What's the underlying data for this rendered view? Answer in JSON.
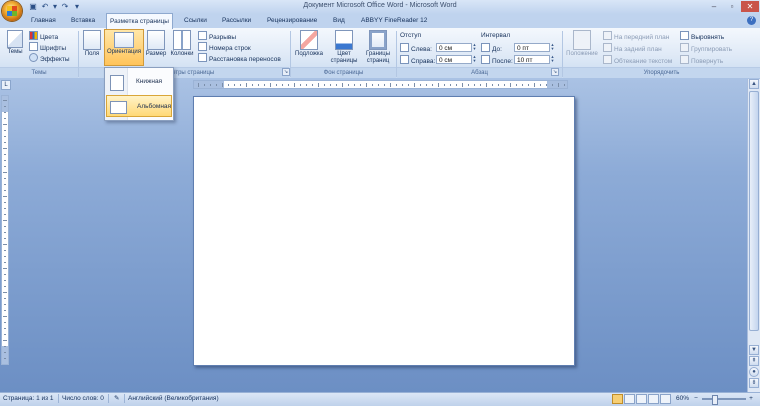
{
  "window": {
    "title": "Документ Microsoft Office Word - Microsoft Word",
    "controls": [
      "–",
      "▫",
      "✕"
    ]
  },
  "qat": {
    "save": "▣",
    "undo": "↶",
    "redo": "↷",
    "more": "▾"
  },
  "tabs": [
    "Главная",
    "Вставка",
    "Разметка страницы",
    "Ссылки",
    "Рассылки",
    "Рецензирование",
    "Вид",
    "ABBYY FineReader 12"
  ],
  "active_tab": "Разметка страницы",
  "help": "?",
  "ribbon": {
    "themes": {
      "big_label": "Темы",
      "colors": "Цвета",
      "fonts": "Шрифты",
      "effects": "Эффекты",
      "group_label": "Темы"
    },
    "page_setup": {
      "margins": "Поля",
      "orientation": "Ориентация",
      "size": "Размер",
      "columns": "Колонки",
      "breaks": "Разрывы",
      "line_numbers": "Номера строк",
      "hyphenation": "Расстановка переносов",
      "group_label": "Параметры страницы"
    },
    "page_background": {
      "watermark": "Подложка",
      "page_color_1": "Цвет",
      "page_color_2": "страницы",
      "borders_1": "Границы",
      "borders_2": "страниц",
      "group_label": "Фон страницы"
    },
    "paragraph": {
      "indent_header": "Отступ",
      "left_label": "Слева:",
      "left_value": "0 см",
      "right_label": "Справа:",
      "right_value": "0 см",
      "spacing_header": "Интервал",
      "before_label": "До:",
      "before_value": "0 пт",
      "after_label": "После:",
      "after_value": "10 пт",
      "group_label": "Абзац"
    },
    "arrange": {
      "position": "Положение",
      "bring_front": "На передний план",
      "send_back": "На задний план",
      "text_wrap": "Обтекание текстом",
      "align": "Выровнять",
      "group": "Группировать",
      "rotate": "Повернуть",
      "group_label": "Упорядочить"
    }
  },
  "orientation_menu": {
    "items": [
      "Книжная",
      "Альбомная"
    ],
    "selected": "Альбомная"
  },
  "ruler_corner": "L",
  "status": {
    "page": "Страница: 1 из 1",
    "words": "Число слов: 0",
    "language": "Английский (Великобритания)",
    "zoom": "60%"
  }
}
